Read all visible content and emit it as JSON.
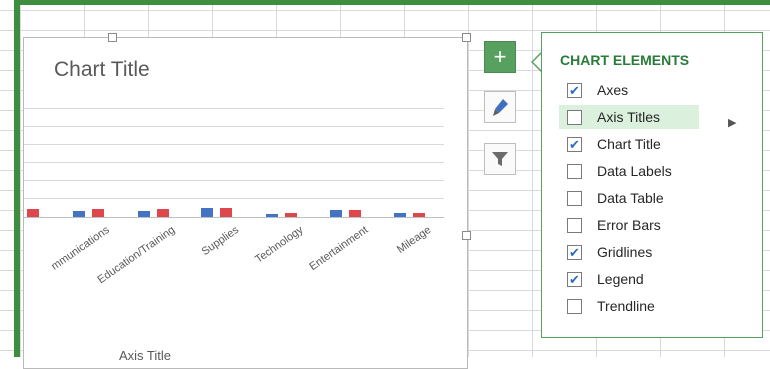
{
  "chart": {
    "title": "Chart Title",
    "axis_title": "Axis Title",
    "categories": [
      "mmunications",
      "Education/Training",
      "Supplies",
      "Technology",
      "Entertainment",
      "Mileage"
    ],
    "series_colors": [
      "#4472c4",
      "#e0474c"
    ]
  },
  "side_buttons": [
    {
      "name": "chart-elements-button",
      "icon": "plus-icon"
    },
    {
      "name": "chart-styles-button",
      "icon": "brush-icon"
    },
    {
      "name": "chart-filters-button",
      "icon": "filter-icon"
    }
  ],
  "panel": {
    "title": "CHART ELEMENTS",
    "items": [
      {
        "label": "Axes",
        "checked": true
      },
      {
        "label": "Axis Titles",
        "checked": false,
        "highlighted": true
      },
      {
        "label": "Chart Title",
        "checked": true
      },
      {
        "label": "Data Labels",
        "checked": false
      },
      {
        "label": "Data Table",
        "checked": false
      },
      {
        "label": "Error Bars",
        "checked": false
      },
      {
        "label": "Gridlines",
        "checked": true
      },
      {
        "label": "Legend",
        "checked": true
      },
      {
        "label": "Trendline",
        "checked": false
      }
    ]
  }
}
